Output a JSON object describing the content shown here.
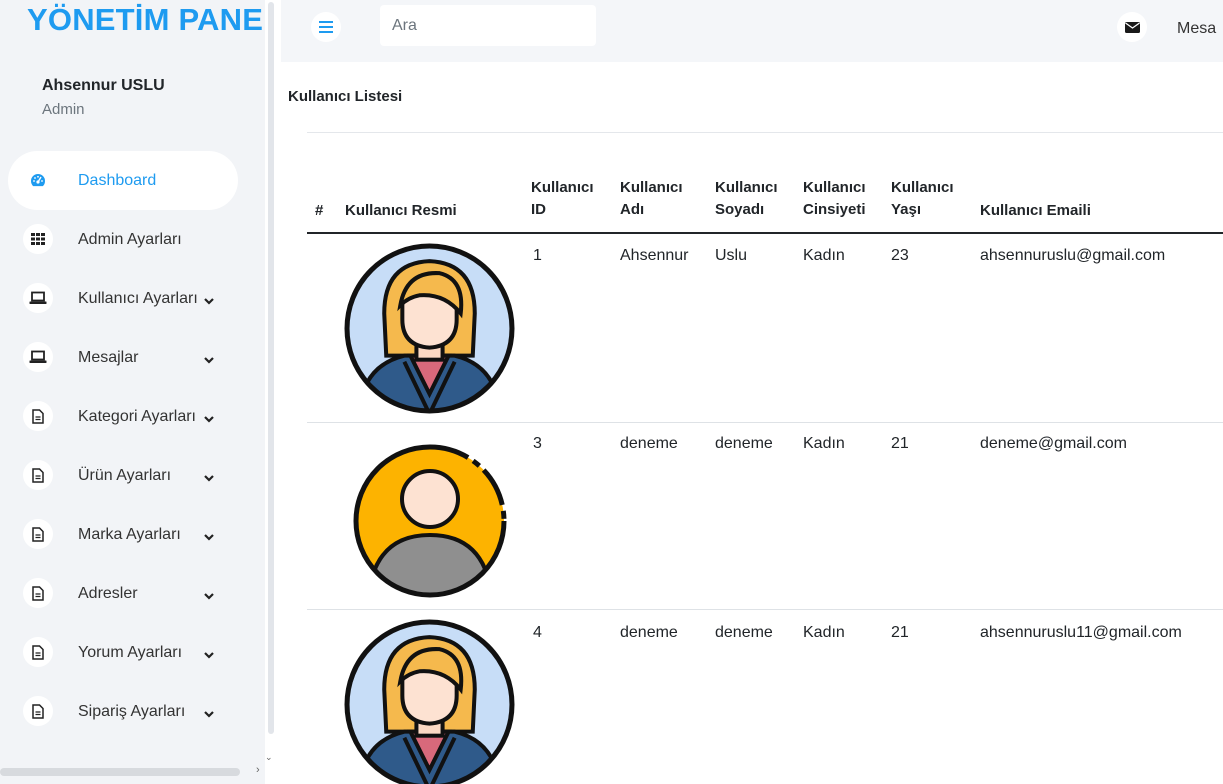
{
  "sidebar": {
    "brand": "YÖNETİM PANEL",
    "user_name": "Ahsennur USLU",
    "user_role": "Admin",
    "items": [
      {
        "label": "Dashboard",
        "icon": "dashboard-icon",
        "active": true,
        "chevron": false
      },
      {
        "label": "Admin Ayarları",
        "icon": "grid-icon",
        "chevron": false
      },
      {
        "label": "Kullanıcı Ayarları",
        "icon": "laptop-icon",
        "chevron": true
      },
      {
        "label": "Mesajlar",
        "icon": "laptop-icon",
        "chevron": true
      },
      {
        "label": "Kategori Ayarları",
        "icon": "file-icon",
        "chevron": true
      },
      {
        "label": "Ürün Ayarları",
        "icon": "file-icon",
        "chevron": true
      },
      {
        "label": "Marka Ayarları",
        "icon": "file-icon",
        "chevron": true
      },
      {
        "label": "Adresler",
        "icon": "file-icon",
        "chevron": true
      },
      {
        "label": "Yorum Ayarları",
        "icon": "file-icon",
        "chevron": true
      },
      {
        "label": "Sipariş Ayarları",
        "icon": "file-icon",
        "chevron": true
      }
    ]
  },
  "topbar": {
    "search_placeholder": "Ara",
    "messages_label": "Mesa"
  },
  "main": {
    "title": "Kullanıcı Listesi",
    "columns": {
      "num": "#",
      "image": "Kullanıcı Resmi",
      "id_1": "Kullanıcı",
      "id_2": "ID",
      "name_1": "Kullanıcı",
      "name_2": "Adı",
      "surname_1": "Kullanıcı",
      "surname_2": "Soyadı",
      "gender_1": "Kullanıcı",
      "gender_2": "Cinsiyeti",
      "age_1": "Kullanıcı",
      "age_2": "Yaşı",
      "email": "Kullanıcı Emaili"
    },
    "rows": [
      {
        "id": "1",
        "name": "Ahsennur",
        "surname": "Uslu",
        "gender": "Kadın",
        "age": "23",
        "email": "ahsennuruslu@gmail.com",
        "avatar": "woman-avatar-icon"
      },
      {
        "id": "3",
        "name": "deneme",
        "surname": "deneme",
        "gender": "Kadın",
        "age": "21",
        "email": "deneme@gmail.com",
        "avatar": "default-user-avatar-icon"
      },
      {
        "id": "4",
        "name": "deneme",
        "surname": "deneme",
        "gender": "Kadın",
        "age": "21",
        "email": "ahsennuruslu11@gmail.com",
        "avatar": "woman-avatar-icon"
      }
    ]
  },
  "colors": {
    "accent": "#1e9bf0",
    "sidebar_bg": "#f2f4f7",
    "topbar_bg": "#f4f6f9",
    "avatar_orange": "#fdb300",
    "avatar_blue": "#c7ddf7"
  }
}
